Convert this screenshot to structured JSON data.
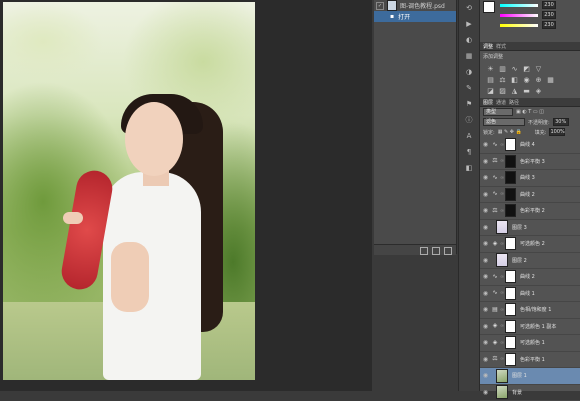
{
  "history": {
    "document_name": "图-调色教程.psd",
    "items": [
      {
        "label": "打开",
        "selected": true
      }
    ]
  },
  "swatches": {
    "values": [
      "230",
      "230",
      "230"
    ]
  },
  "adjustments": {
    "tabs": [
      "调整",
      "样式"
    ],
    "title": "添加调整"
  },
  "layers": {
    "tabs": [
      "图层",
      "通道",
      "路径"
    ],
    "kind_filter": "类型",
    "blend_mode": "滤色",
    "opacity_label": "不透明度:",
    "opacity_value": "30%",
    "lock_label": "锁定:",
    "fill_label": "填充:",
    "fill_value": "100%",
    "items": [
      {
        "name": "曲线 4",
        "type": "curves",
        "mask": "white"
      },
      {
        "name": "色彩平衡 3",
        "type": "balance",
        "mask": "black"
      },
      {
        "name": "曲线 3",
        "type": "curves",
        "mask": "black"
      },
      {
        "name": "曲线 2",
        "type": "curves",
        "mask": "black"
      },
      {
        "name": "色彩平衡 2",
        "type": "balance",
        "mask": "black"
      },
      {
        "name": "图层 3",
        "type": "pixel"
      },
      {
        "name": "可选颜色 2",
        "type": "selective",
        "mask": "white"
      },
      {
        "name": "图层 2",
        "type": "pixel"
      },
      {
        "name": "曲线 2",
        "type": "curves",
        "mask": "white"
      },
      {
        "name": "曲线 1",
        "type": "curves",
        "mask": "white"
      },
      {
        "name": "色相/饱和度 1",
        "type": "huesat",
        "mask": "white"
      },
      {
        "name": "可选颜色 1 副本",
        "type": "selective",
        "mask": "white"
      },
      {
        "name": "可选颜色 1",
        "type": "selective",
        "mask": "white"
      },
      {
        "name": "色彩平衡 1",
        "type": "balance",
        "mask": "white"
      },
      {
        "name": "图层 1",
        "type": "photo",
        "selected": true
      },
      {
        "name": "背景",
        "type": "photo"
      }
    ]
  }
}
